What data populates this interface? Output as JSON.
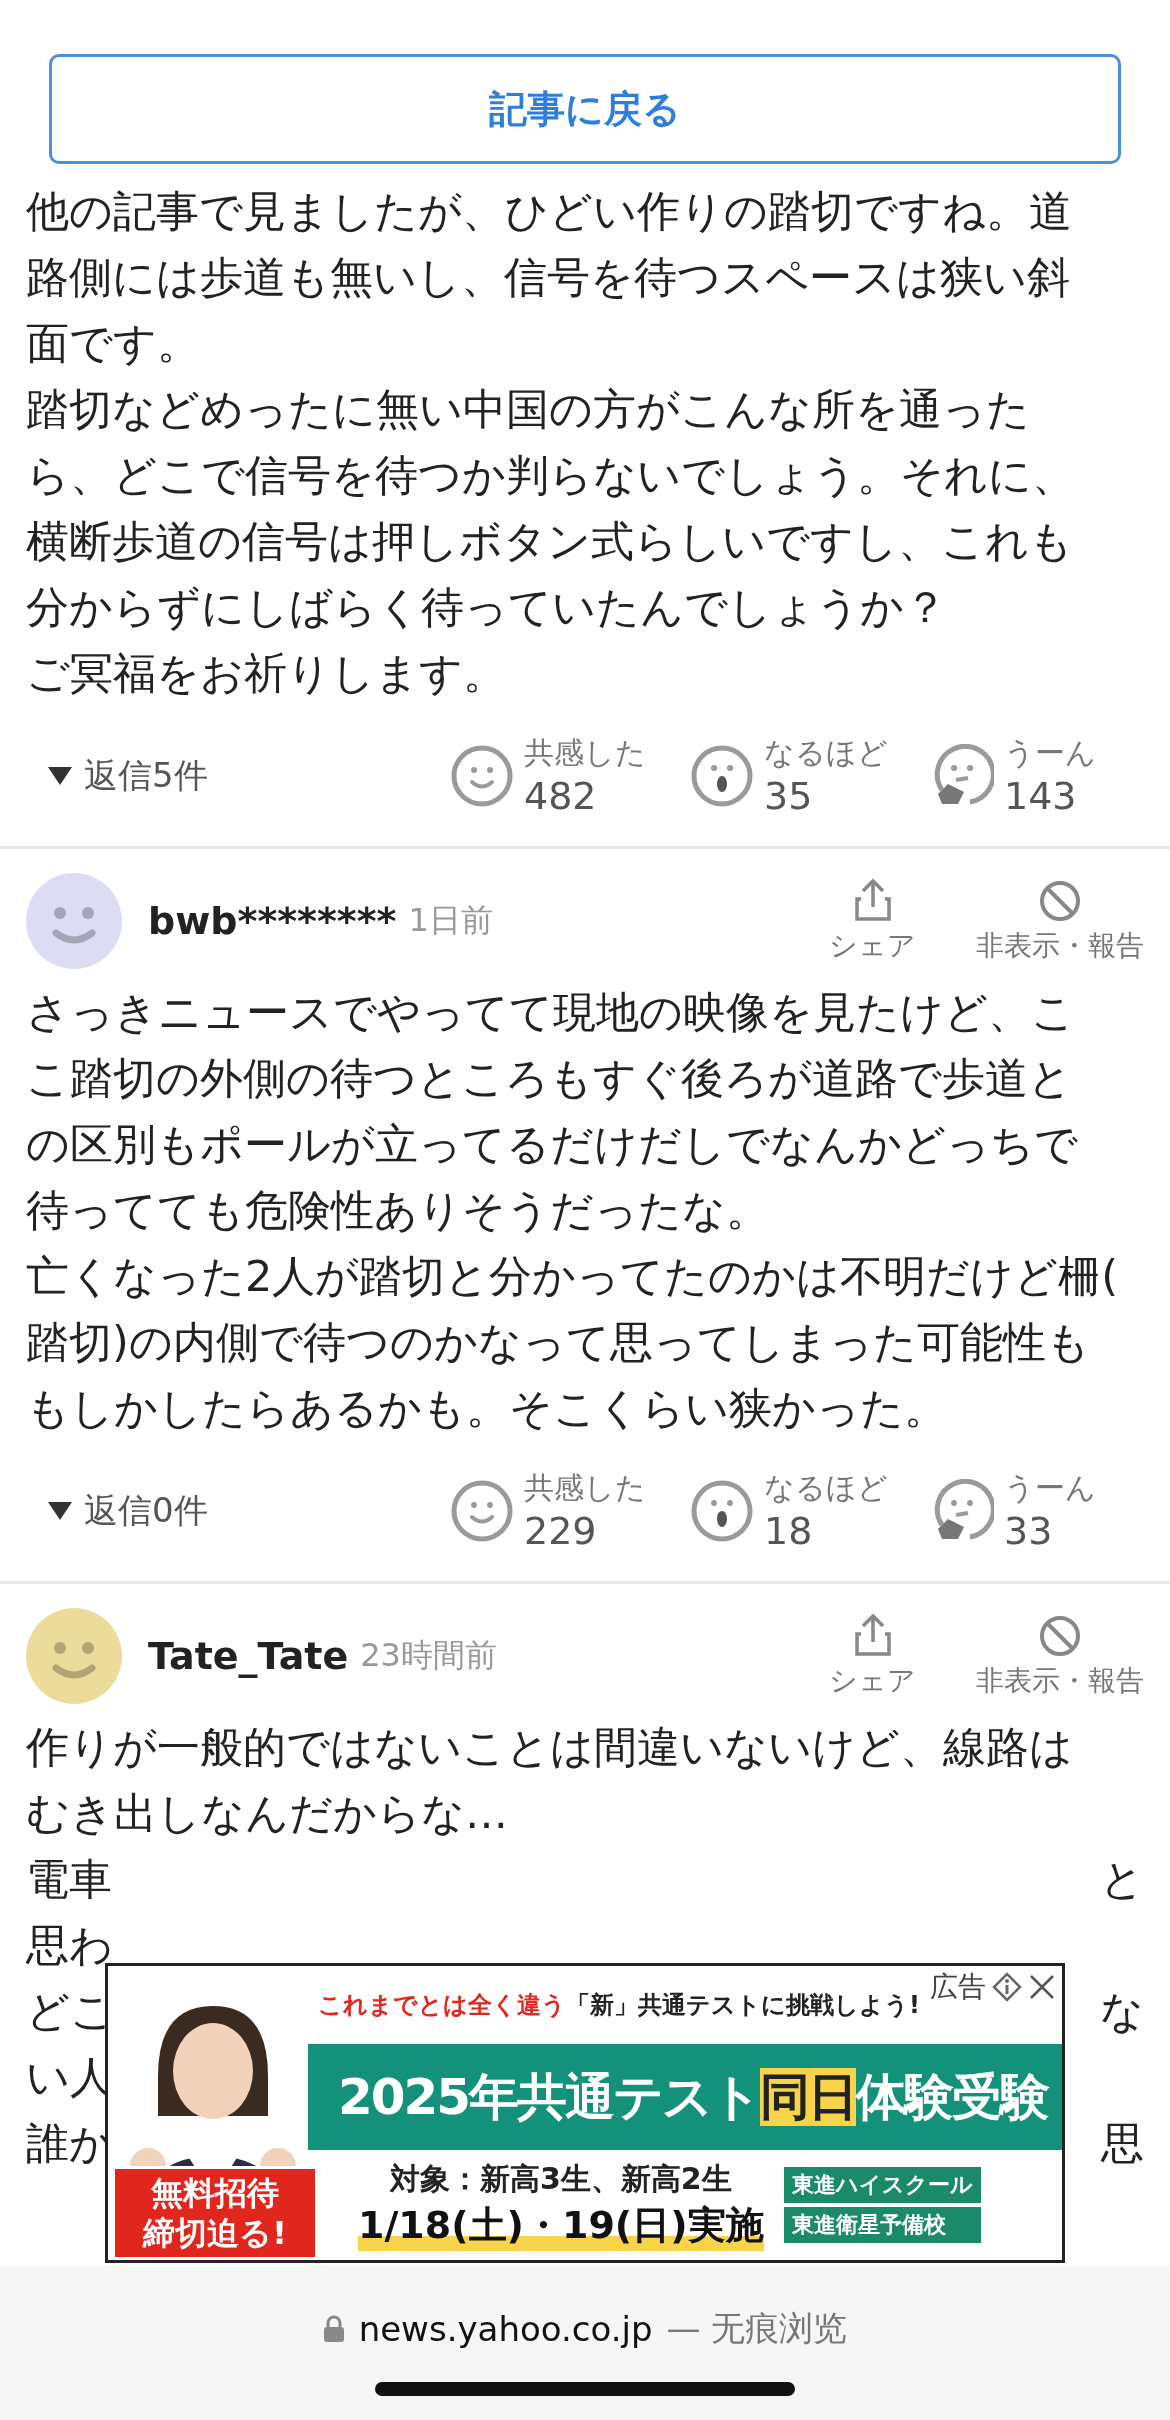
{
  "back_button": "記事に戻る",
  "comments": [
    {
      "lines": [
        "他の記事で見ましたが、ひどい作りの踏切ですね。道",
        "路側には歩道も無いし、信号を待つスペースは狭い斜",
        "面です。",
        "踏切などめったに無い中国の方がこんな所を通った",
        "ら、どこで信号を待つか判らないでしょう。それに、",
        "横断歩道の信号は押しボタン式らしいですし、これも",
        "分からずにしばらく待っていたんでしょうか？",
        "ご冥福をお祈りします。"
      ],
      "replies": "返信5件",
      "reactions": [
        {
          "kind": "smile",
          "label": "共感した",
          "count": "482"
        },
        {
          "kind": "surprise",
          "label": "なるほど",
          "count": "35"
        },
        {
          "kind": "hmm",
          "label": "うーん",
          "count": "143"
        }
      ]
    },
    {
      "user": {
        "name": "bwb********",
        "time": "1日前",
        "color": "#dcdcf4"
      },
      "actions": [
        {
          "kind": "share",
          "label": "シェア"
        },
        {
          "kind": "hide",
          "label": "非表示・報告"
        }
      ],
      "lines": [
        "さっきニュースでやってて現地の映像を見たけど、こ",
        "こ踏切の外側の待つところもすぐ後ろが道路で歩道と",
        "の区別もポールが立ってるだけだしでなんかどっちで",
        "待ってても危険性ありそうだったな。",
        "亡くなった2人が踏切と分かってたのかは不明だけど柵(",
        "踏切)の内側で待つのかなって思ってしまった可能性も",
        "もしかしたらあるかも。そこくらい狭かった。"
      ],
      "replies": "返信0件",
      "reactions": [
        {
          "kind": "smile",
          "label": "共感した",
          "count": "229"
        },
        {
          "kind": "surprise",
          "label": "なるほど",
          "count": "18"
        },
        {
          "kind": "hmm",
          "label": "うーん",
          "count": "33"
        }
      ]
    },
    {
      "user": {
        "name": "Tate_Tate",
        "time": "23時間前",
        "color": "#ecdc9c"
      },
      "actions": [
        {
          "kind": "share",
          "label": "シェア"
        },
        {
          "kind": "hide",
          "label": "非表示・報告"
        }
      ],
      "lines": [
        "作りが一般的ではないことは間違いないけど、線路は",
        "むき出しなんだからな…"
      ],
      "partial_lines": [
        {
          "left": "電車",
          "right": "と"
        },
        {
          "left": "思わ"
        },
        {
          "left": "どこ",
          "right": "な"
        },
        {
          "left": "い人"
        },
        {
          "left": "誰か",
          "right": "思"
        }
      ]
    }
  ],
  "ad": {
    "label": "広告",
    "headline_red": "これまでとは全く違う",
    "headline_black": "「新」共通テストに挑戦しよう!",
    "title_parts": [
      {
        "text": "2025年共通テスト",
        "highlight": false
      },
      {
        "text": "同日",
        "highlight": true
      },
      {
        "text": "体験受験",
        "highlight": false
      }
    ],
    "badge": [
      "無料招待",
      "締切迫る!"
    ],
    "target": "対象：新高3生、新高2生",
    "date": "1/18(土)・19(日)実施",
    "logos": [
      "東進ハイスクール",
      "東進衛星予備校"
    ]
  },
  "address_bar": {
    "domain": "news.yahoo.co.jp",
    "mode": "— 无痕浏览"
  }
}
